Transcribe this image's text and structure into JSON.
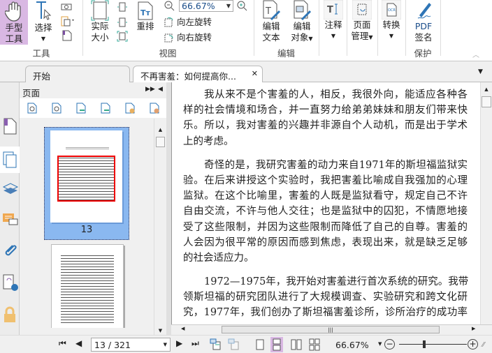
{
  "ribbon": {
    "hand_tool": "手型\n工具",
    "hand_line1": "手型",
    "hand_line2": "工具",
    "select": "选择",
    "actual_size_1": "实际",
    "actual_size_2": "大小",
    "reflow": "重排",
    "zoom_value": "66.67%",
    "rotate_left": "向左旋转",
    "rotate_right": "向右旋转",
    "edit_text_1": "编辑",
    "edit_text_2": "文本",
    "edit_object_1": "编辑",
    "edit_object_2": "对象",
    "annotate": "注释",
    "page_manage_1": "页面",
    "page_manage_2": "管理",
    "convert": "转换",
    "pdf_sign_1": "PDF",
    "pdf_sign_2": "签名",
    "groups": {
      "tools": "工具",
      "view": "视图",
      "edit": "编辑",
      "protect": "保护"
    }
  },
  "tabs": [
    {
      "label": "开始"
    },
    {
      "label": "不再害羞：如何提高你..."
    }
  ],
  "panel": {
    "title": "页面",
    "thumb_page": "13"
  },
  "document": {
    "paragraphs": [
      [
        "我从来不是个害羞的人，相反，我很外向，能适应各种各",
        "样的社会情境和场合，并一直努力给弟弟妹妹和朋友们带来快",
        "乐。所以，我对害羞的兴趣并非源自个人动机，而是出于学术",
        "上的考虑。"
      ],
      [
        "奇怪的是，我研究害羞的动力来自1971年的斯坦福监狱实",
        "验。在后来讲授这个实验时，我把害羞比喻成自我强加的心理",
        "监狱。在这个比喻里，害羞的人既是监狱看守，规定自己不许",
        "自由交流，不许与他人交往；也是监狱中的囚犯，不情愿地接",
        "受了这些限制，并因为这些限制而降低了自己的自尊。害羞的",
        "人会因为很平常的原因而感到焦虑，表现出来，就是缺乏足够",
        "的社会适应力。"
      ],
      [
        "1972—1975年，我开始对害羞进行首次系统的研究。我带",
        "领斯坦福的研究团队进行了大规模调查、实验研究和跨文化研",
        "究，1977年，我们创办了斯坦福害羞诊所，诊所治疗的成功率"
      ]
    ]
  },
  "status": {
    "page_field": "13 / 321",
    "zoom": "66.67%",
    "zoom_fraction": 0.35
  },
  "colors": {
    "accent": "#2e75b6",
    "active": "#d9b8e3",
    "thumb_sel": "#8ab8f0"
  }
}
